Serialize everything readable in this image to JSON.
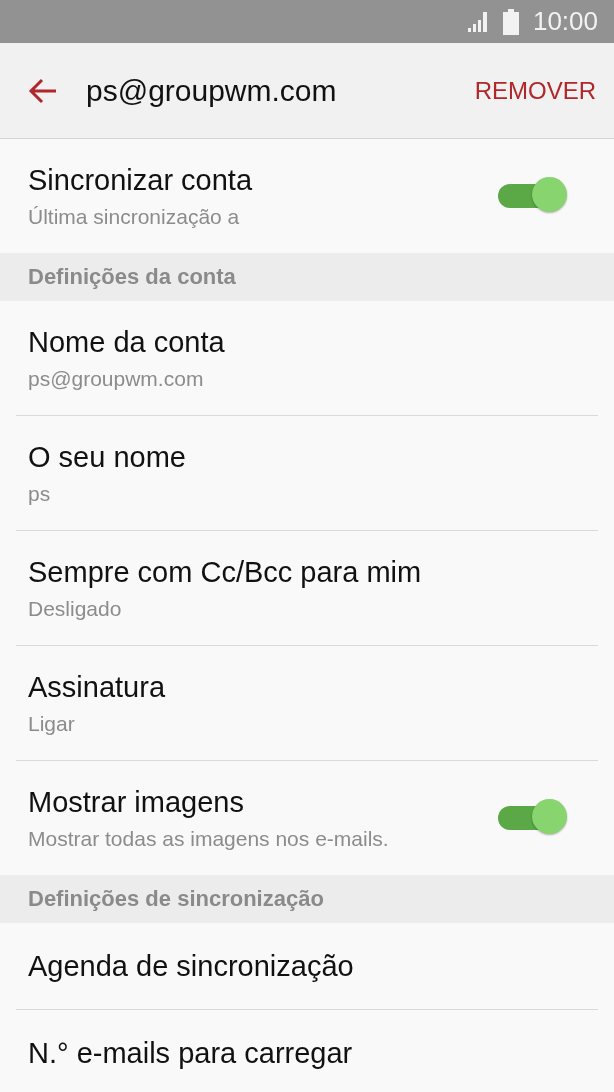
{
  "status_bar": {
    "time": "10:00"
  },
  "app_bar": {
    "title": "ps@groupwm.com",
    "action": "REMOVER"
  },
  "items": [
    {
      "kind": "switch",
      "title": "Sincronizar conta",
      "subtitle": "Última sincronização a",
      "on": true
    },
    {
      "kind": "header",
      "title": "Definições da conta"
    },
    {
      "kind": "setting",
      "title": "Nome da conta",
      "subtitle": "ps@groupwm.com"
    },
    {
      "kind": "setting",
      "title": "O seu nome",
      "subtitle": "ps"
    },
    {
      "kind": "setting",
      "title": "Sempre com Cc/Bcc para mim",
      "subtitle": "Desligado"
    },
    {
      "kind": "setting",
      "title": "Assinatura",
      "subtitle": "Ligar"
    },
    {
      "kind": "switch",
      "title": "Mostrar imagens",
      "subtitle": "Mostrar todas as imagens nos e-mails.",
      "on": true
    },
    {
      "kind": "header",
      "title": "Definições de sincronização"
    },
    {
      "kind": "setting",
      "title": "Agenda de sincronização"
    },
    {
      "kind": "setting",
      "title": "N.° e-mails para carregar"
    }
  ]
}
